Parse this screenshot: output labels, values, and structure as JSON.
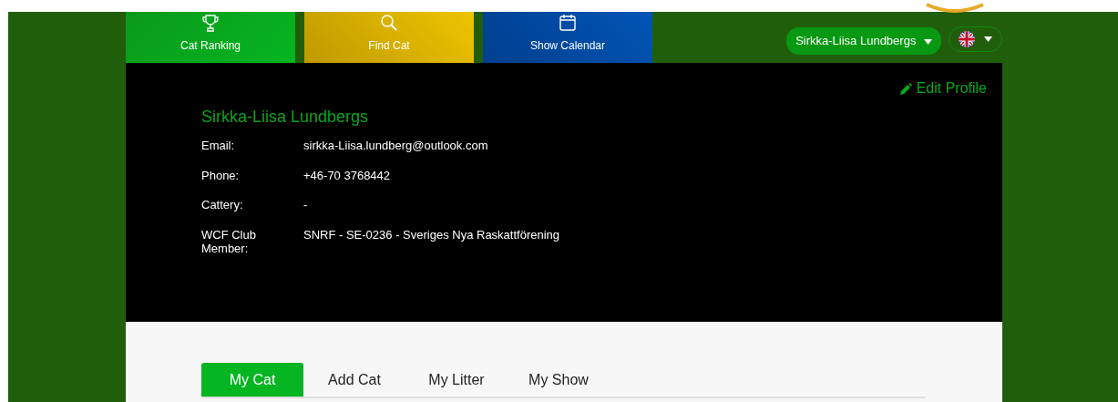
{
  "nav_tiles": [
    {
      "kind": "trophy",
      "label": "Cat Ranking"
    },
    {
      "kind": "search",
      "label": "Find Cat"
    },
    {
      "kind": "calendar",
      "label": "Show Calendar"
    }
  ],
  "user_menu": {
    "label": "Sirkka-Liisa Lundbergs"
  },
  "profile": {
    "edit_link": "Edit Profile",
    "name": "Sirkka-Liisa Lundbergs",
    "fields": [
      {
        "label": "Email:",
        "value": "sirkka-Liisa.lundberg@outlook.com"
      },
      {
        "label": "Phone:",
        "value": "+46-70 3768442"
      },
      {
        "label": "Cattery:",
        "value": "-"
      },
      {
        "label": "WCF Club Member:",
        "value": "SNRF - SE-0236 - Sveriges Nya Raskattförening"
      }
    ]
  },
  "tabs": [
    {
      "label": "My Cat",
      "selected": true
    },
    {
      "label": "Add Cat",
      "selected": false
    },
    {
      "label": "My Litter",
      "selected": false
    },
    {
      "label": "My Show",
      "selected": false
    }
  ]
}
